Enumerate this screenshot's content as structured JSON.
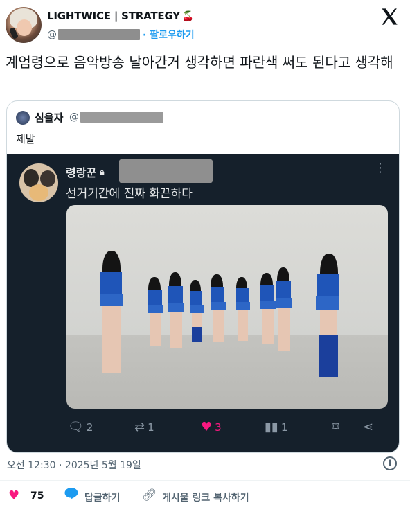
{
  "author": {
    "display_name": "LIGHTWICE | STRATEGY",
    "badge_emoji": "🍒",
    "handle_prefix": "@",
    "follow_label": "· 팔로우하기"
  },
  "tweet": {
    "text": "계엄령으로 음악방송 날아간거 생각하면 파란색 써도 된다고 생각해",
    "timestamp": "오전 12:30 · 2025년 5월 19일"
  },
  "quote": {
    "display_name": "심을자",
    "handle_prefix": "@",
    "text": "제발",
    "screenshot": {
      "display_name": "령랑꾼",
      "lock_icon": "lock-icon",
      "text": "선거기간에 진짜 화끈하다",
      "actions": {
        "reply_count": "2",
        "retweet_count": "1",
        "like_count": "3",
        "views_count": "1"
      }
    }
  },
  "footer": {
    "like_count": "75",
    "reply_label": "답글하기",
    "copy_link_label": "게시물 링크 복사하기"
  },
  "colors": {
    "accent": "#1d9bf0",
    "like": "#f91880",
    "dark_bg": "#15202b"
  }
}
